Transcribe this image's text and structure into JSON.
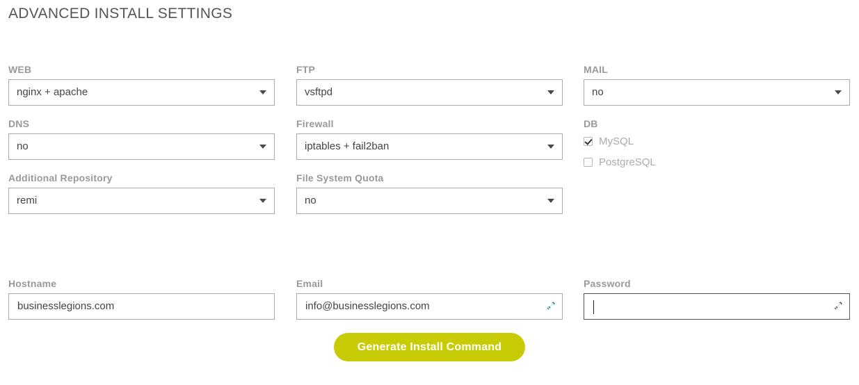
{
  "page": {
    "title": "ADVANCED INSTALL SETTINGS"
  },
  "columns": {
    "col1": [
      {
        "label": "WEB",
        "value": "nginx + apache",
        "name": "web"
      },
      {
        "label": "DNS",
        "value": "no",
        "name": "dns"
      },
      {
        "label": "Additional Repository",
        "value": "remi",
        "name": "additional-repository"
      }
    ],
    "col2": [
      {
        "label": "FTP",
        "value": "vsftpd",
        "name": "ftp"
      },
      {
        "label": "Firewall",
        "value": "iptables + fail2ban",
        "name": "firewall"
      },
      {
        "label": "File System Quota",
        "value": "no",
        "name": "file-system-quota"
      }
    ],
    "col3": {
      "mail": {
        "label": "MAIL",
        "value": "no"
      },
      "db": {
        "label": "DB",
        "options": [
          {
            "label": "MySQL",
            "checked": true
          },
          {
            "label": "PostgreSQL",
            "checked": false
          }
        ]
      }
    }
  },
  "inputs": {
    "hostname": {
      "label": "Hostname",
      "value": "businesslegions.com",
      "placeholder": "",
      "icon": "",
      "focused": false
    },
    "email": {
      "label": "Email",
      "value": "info@businesslegions.com",
      "placeholder": "",
      "icon": "generate-icon",
      "focused": false
    },
    "password": {
      "label": "Password",
      "value": "",
      "placeholder": "",
      "icon": "generate-icon",
      "focused": true
    }
  },
  "submit": {
    "label": "Generate Install Command"
  },
  "colors": {
    "button": "#c8cc06",
    "label": "#999999",
    "title": "#555555",
    "text": "#444444",
    "border": "#aaaaaa",
    "border_focus": "#555555",
    "icon_active": "#1b7f96",
    "icon_inactive": "#555555"
  }
}
